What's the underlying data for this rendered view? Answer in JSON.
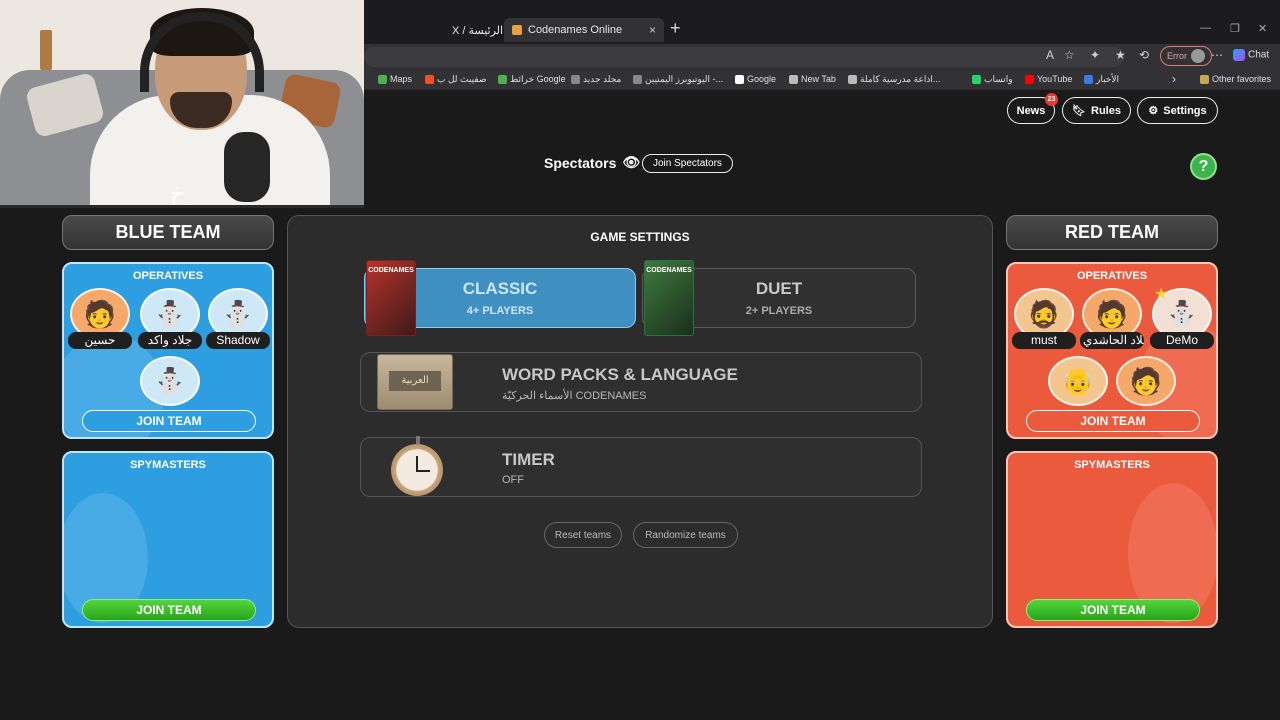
{
  "browser": {
    "tabs": [
      {
        "label": "X / الرئيسة"
      },
      {
        "label": "Codenames Online"
      }
    ],
    "error_label": "Error",
    "chat_label": "Chat",
    "favorites": [
      {
        "label": "Maps",
        "color": "#4caf50"
      },
      {
        "label": "صفيبث لل ب",
        "color": "#f25022"
      },
      {
        "label": "خرائط Google",
        "color": "#4caf50"
      },
      {
        "label": "مجلد جديد",
        "color": "#888888"
      },
      {
        "label": "اليوتيوبرز اليمنيين -...",
        "color": "#888888"
      },
      {
        "label": "Google",
        "color": "#ffffff"
      },
      {
        "label": "New Tab",
        "color": "#bbbbbb"
      },
      {
        "label": "اذاعة مدرسية كاملة...",
        "color": "#bbbbbb"
      },
      {
        "label": "واتساب",
        "color": "#25d366"
      },
      {
        "label": "YouTube",
        "color": "#ff0000"
      },
      {
        "label": "الأخبار",
        "color": "#3d7be0"
      }
    ],
    "other_favorites": "Other favorites"
  },
  "header": {
    "news_label": "News",
    "news_badge": "23",
    "rules_label": "Rules",
    "settings_label": "Settings",
    "spectators_label": "Spectators",
    "join_spectators": "Join Spectators",
    "help_glyph": "?"
  },
  "blue_team": {
    "title": "BLUE TEAM",
    "operatives_title": "OPERATIVES",
    "operatives": [
      {
        "name": "حسين"
      },
      {
        "name": "جلاد واكد"
      },
      {
        "name": "Shadow"
      }
    ],
    "join_team": "JOIN TEAM",
    "spymasters_title": "SPYMASTERS",
    "spymaster_join": "JOIN TEAM"
  },
  "red_team": {
    "title": "RED TEAM",
    "operatives_title": "OPERATIVES",
    "operatives": [
      {
        "name": "must"
      },
      {
        "name": "جلاد الحاشدي"
      },
      {
        "name": "DeMo"
      }
    ],
    "join_team": "JOIN TEAM",
    "spymasters_title": "SPYMASTERS",
    "spymaster_join": "JOIN TEAM"
  },
  "settings": {
    "title": "GAME SETTINGS",
    "modes": [
      {
        "title": "CLASSIC",
        "subtitle": "4+ PLAYERS",
        "selected": true,
        "box_label": "CODENAMES"
      },
      {
        "title": "DUET",
        "subtitle": "2+ PLAYERS",
        "selected": false,
        "box_label": "CODENAMES"
      }
    ],
    "word_packs": {
      "title": "WORD PACKS & LANGUAGE",
      "subtitle": "الأسماء الحركيّة CODENAMES",
      "box_label": "العربية"
    },
    "timer": {
      "title": "TIMER",
      "subtitle": "OFF"
    },
    "reset_teams": "Reset teams",
    "randomize_teams": "Randomize teams"
  },
  "colors": {
    "blue_panel": "#2d9ee0",
    "red_panel": "#ec5a3e",
    "classic_selected": "#3f8fc0",
    "join_green": "#27a51a"
  }
}
